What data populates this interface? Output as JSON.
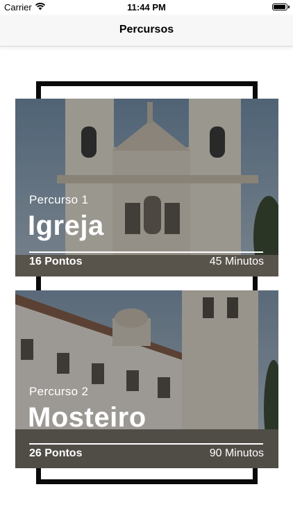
{
  "status_bar": {
    "carrier": "Carrier",
    "time": "11:44 PM",
    "battery_level": 1.0
  },
  "nav": {
    "title": "Percursos"
  },
  "routes": [
    {
      "number_label": "Percurso 1",
      "name": "Igreja",
      "points": "16 Pontos",
      "duration": "45 Minutos"
    },
    {
      "number_label": "Percurso 2",
      "name": "Mosteiro",
      "points": "26 Pontos",
      "duration": "90 Minutos"
    }
  ],
  "colors": {
    "frame": "#0a0a0a",
    "nav_background": "#f7f7f7",
    "card_text": "#ffffff"
  }
}
